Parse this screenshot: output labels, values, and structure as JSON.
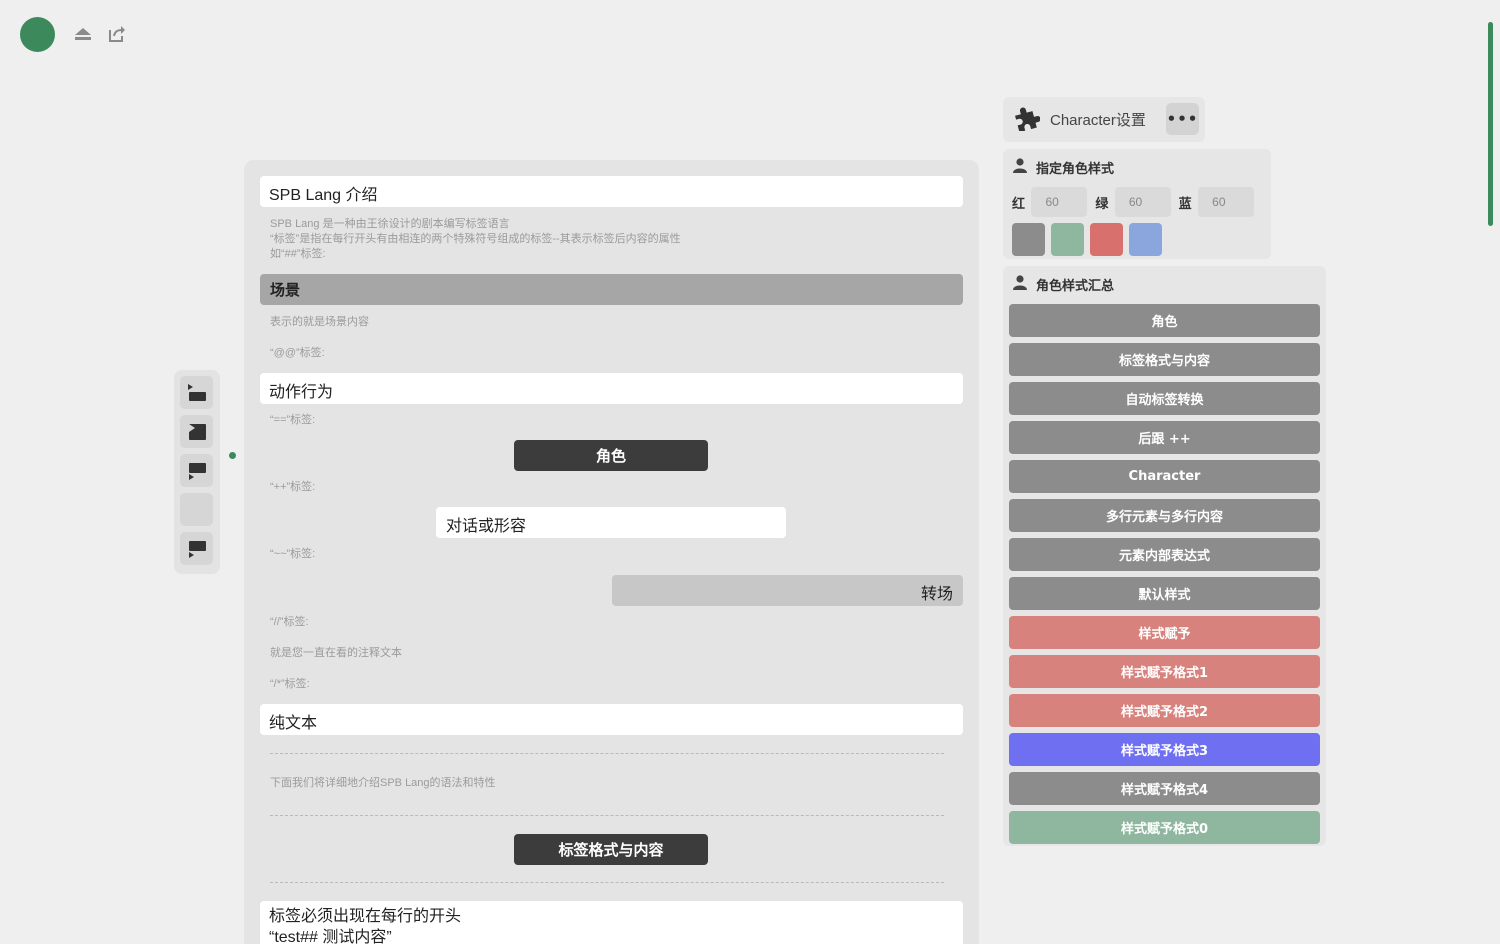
{
  "topbar": {
    "eject_icon": "eject-icon",
    "share_icon": "share-icon"
  },
  "colors": {
    "accent": "#3c8a5c",
    "gray_btn": "#8c8c8c",
    "red_btn": "#d8827d",
    "blue_btn": "#6f6ff2",
    "green_btn": "#8fb7a0"
  },
  "toolstrip": {
    "items": [
      "scene-tool-icon",
      "action-tool-icon",
      "dialog-tool-icon",
      "blank-tool",
      "comment-tool-icon"
    ]
  },
  "doc": {
    "title": "SPB Lang 介绍",
    "intro_lines": [
      "SPB Lang 是一种由王徐设计的剧本编写标签语言",
      "“标签”是指在每行开头有由相连的两个特殊符号组成的标签--其表示标签后内容的属性",
      "如“##”标签:"
    ],
    "scene_label": "场景",
    "scene_note": "表示的就是场景内容",
    "at_tag_note": "“@@”标签:",
    "action_text": "动作行为",
    "eq_tag_note": "“==”标签:",
    "role_text": "角色",
    "plus_tag_note": "“++”标签:",
    "dialog_text": "对话或形容",
    "tilde_tag_note": "“~~”标签:",
    "transition_text": "转场",
    "slash_tag_note": "“//”标签:",
    "comment_note": "就是您一直在看的注释文本",
    "star_tag_note": "“/*”标签:",
    "plain_text": "纯文本",
    "next_note": "下面我们将详细地介绍SPB Lang的语法和特性",
    "section_btn": "标签格式与内容",
    "rule_line1": "标签必须出现在每行的开头",
    "rule_line2": "“test## 测试内容”"
  },
  "char_panel": {
    "title": "Character设置",
    "more_label": "•••"
  },
  "style_card": {
    "title": "指定角色样式",
    "red_label": "红",
    "red_value": "60",
    "green_label": "绿",
    "green_value": "60",
    "blue_label": "蓝",
    "blue_value": "60",
    "swatches": [
      "#8c8c8c",
      "#8fb7a0",
      "#d8706e",
      "#8aa6dd"
    ]
  },
  "summary_card": {
    "title": "角色样式汇总",
    "buttons": [
      {
        "label": "角色",
        "color": "#8c8c8c"
      },
      {
        "label": "标签格式与内容",
        "color": "#8c8c8c"
      },
      {
        "label": "自动标签转换",
        "color": "#8c8c8c"
      },
      {
        "label": "后跟 ++",
        "color": "#8c8c8c"
      },
      {
        "label": "Character",
        "color": "#8c8c8c"
      },
      {
        "label": "多行元素与多行内容",
        "color": "#8c8c8c"
      },
      {
        "label": "元素内部表达式",
        "color": "#8c8c8c"
      },
      {
        "label": "默认样式",
        "color": "#8c8c8c"
      },
      {
        "label": "样式赋予",
        "color": "#d8827d"
      },
      {
        "label": "样式赋予格式1",
        "color": "#d8827d"
      },
      {
        "label": "样式赋予格式2",
        "color": "#d8827d"
      },
      {
        "label": "样式赋予格式3",
        "color": "#6f6ff2"
      },
      {
        "label": "样式赋予格式4",
        "color": "#8c8c8c"
      },
      {
        "label": "样式赋予格式0",
        "color": "#8fb7a0"
      }
    ]
  }
}
